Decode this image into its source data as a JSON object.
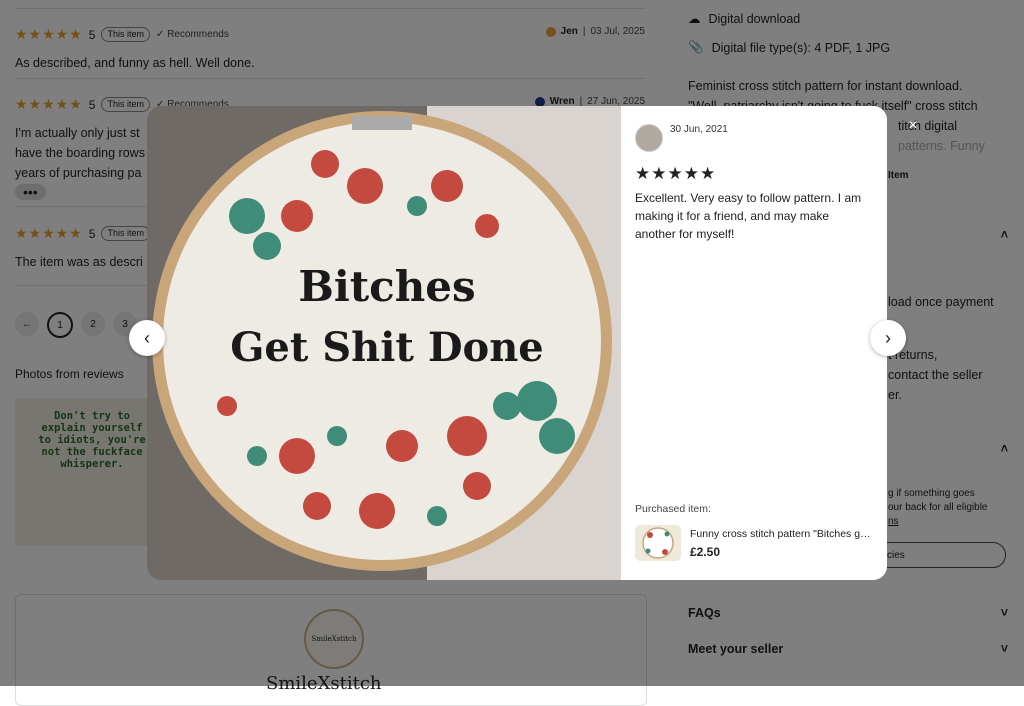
{
  "reviews": [
    {
      "rating": "5",
      "badge": "This item",
      "recommends": "✓ Recommends",
      "author": "Jen",
      "date": "03 Jul, 2025",
      "text": "As described, and funny as hell. Well done."
    },
    {
      "rating": "5",
      "badge": "This item",
      "recommends": "✓ Recommends",
      "author": "Wren",
      "date": "27 Jun, 2025",
      "text": "I'm actually only just st",
      "text2": "have the boarding rows",
      "text3": "years of purchasing pa",
      "more": "•••"
    },
    {
      "rating": "5",
      "badge": "This item",
      "text": "The item was as descri"
    }
  ],
  "pagination": {
    "prev": "←",
    "pages": [
      "1",
      "2",
      "3"
    ]
  },
  "photos_label": "Photos from reviews",
  "review_photo_text": "Don't try to explain yourself to idiots, you're not the fuckface whisperer.",
  "shop": {
    "logo_text": "SmileXstitch",
    "name": "SmileXstitch"
  },
  "right": {
    "digital_download": "Digital download",
    "file_types": "Digital file type(s): 4 PDF, 1 JPG",
    "desc_1": "Feminist cross stitch pattern for instant download.",
    "desc_2": "\"Well, patriarchy isn't going to fuck itself\" cross stitch",
    "desc_3": "titch digital",
    "desc_4": "patterns. Funny",
    "item_label": "Item",
    "download_text": "load once payment",
    "returns_text": "t returns,",
    "contact_text": "contact the seller",
    "er_text": "er.",
    "small_1": "g if something goes",
    "small_2": "our back for all eligible",
    "small_3": "ns",
    "policies_btn": "olicies",
    "faqs": "FAQs",
    "meet_seller": "Meet your seller"
  },
  "modal": {
    "date": "30 Jun, 2021",
    "stars": "★★★★★",
    "text": "Excellent. Very easy to follow pattern. I am making it for a friend, and may make another for myself!",
    "purchased_label": "Purchased item:",
    "item_title": "Funny cross stitch pattern \"Bitches get shit done\"",
    "item_price": "£2.50",
    "photo_line1": "Bitches",
    "photo_line2": "Get Shit Done",
    "close": "×",
    "prev": "‹",
    "next": "›"
  }
}
